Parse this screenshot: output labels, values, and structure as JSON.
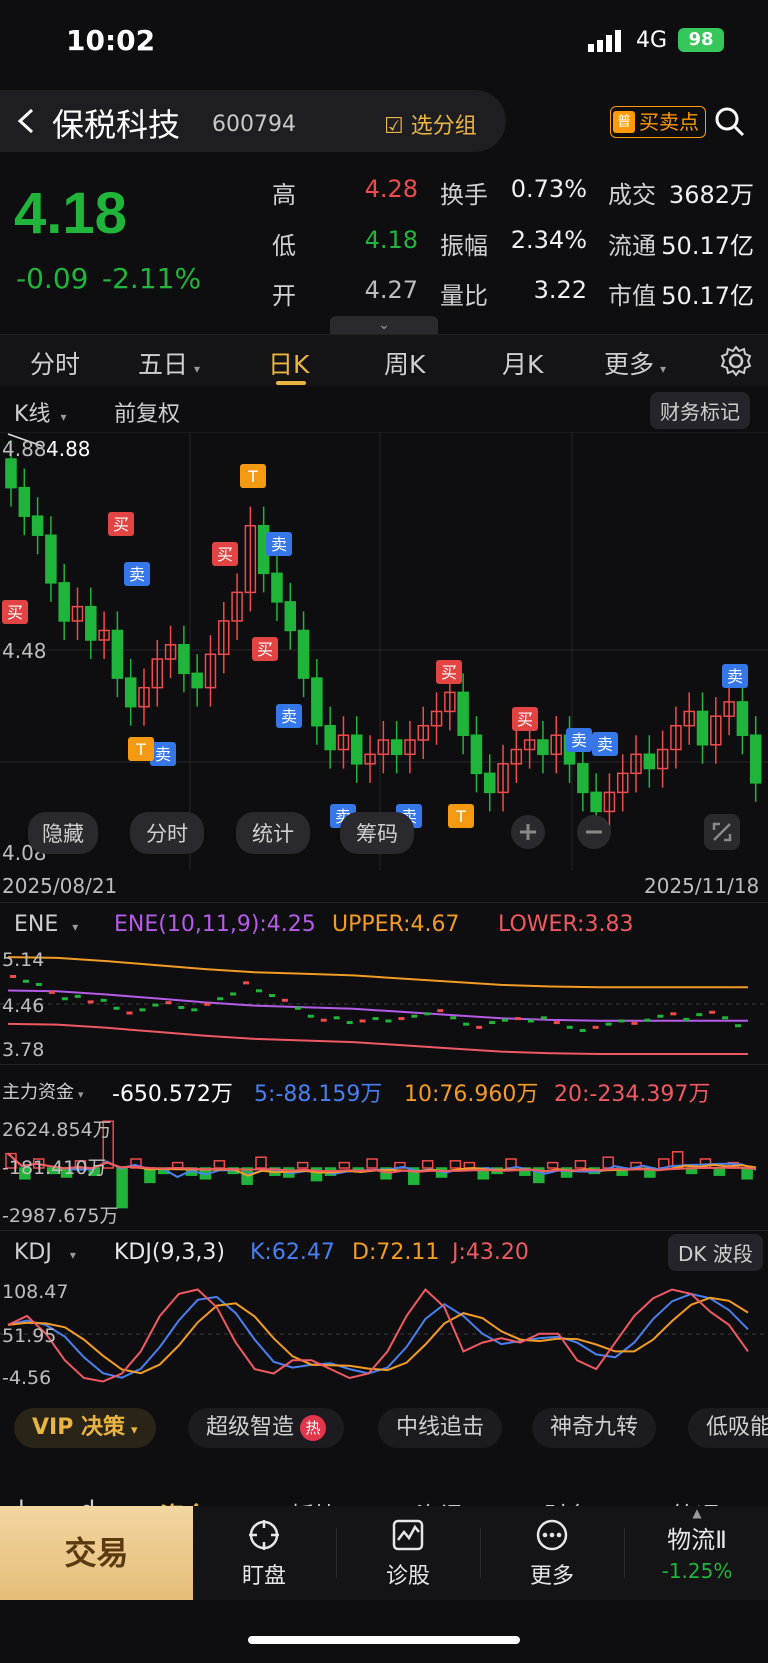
{
  "status": {
    "time": "10:02",
    "network": "4G",
    "battery": "98"
  },
  "header": {
    "stock_name": "保税科技",
    "stock_code": "600794",
    "group_label": "选分组",
    "bsp_badge": "普",
    "bsp_label": "买卖点"
  },
  "quote": {
    "price": "4.18",
    "change_abs": "-0.09",
    "change_pct": "-2.11%",
    "rows": [
      {
        "l1": "高",
        "v1": "4.28",
        "l2": "换手",
        "v2": "0.73%",
        "l3": "成交",
        "v3": "3682万"
      },
      {
        "l1": "低",
        "v1": "4.18",
        "l2": "振幅",
        "v2": "2.34%",
        "l3": "流通",
        "v3": "50.17亿"
      },
      {
        "l1": "开",
        "v1": "4.27",
        "l2": "量比",
        "v2": "3.22",
        "l3": "市值",
        "v3": "50.17亿"
      }
    ]
  },
  "period_tabs": [
    "分时",
    "五日",
    "日K",
    "周K",
    "月K",
    "更多"
  ],
  "kline": {
    "type_label": "K线",
    "adjust_label": "前复权",
    "finance_mark": "财务标记",
    "price_high": "4.88",
    "price_mid": "4.48",
    "price_low": "4.08",
    "date_start": "2025/08/21",
    "date_end": "2025/11/18",
    "chips": [
      "隐藏",
      "分时",
      "统计",
      "筹码"
    ]
  },
  "signals": {
    "buy": "买",
    "sell": "卖",
    "t": "T"
  },
  "ene": {
    "label": "ENE",
    "params": "ENE(10,11,9):4.25",
    "upper": "UPPER:4.67",
    "lower": "LOWER:3.83",
    "axis_top": "5.14",
    "axis_mid": "4.46",
    "axis_bot": "3.78"
  },
  "capital": {
    "label": "主力资金",
    "value": "-650.572万",
    "ma5": "5:-88.159万",
    "ma10": "10:76.960万",
    "ma20": "20:-234.397万",
    "axis_top": "2624.854万",
    "axis_mid": "-181.410万",
    "axis_bot": "-2987.675万"
  },
  "kdj": {
    "label": "KDJ",
    "params": "KDJ(9,3,3)",
    "k": "K:62.47",
    "d": "D:72.11",
    "j": "J:43.20",
    "dk_label": "DK 波段",
    "axis_top": "108.47",
    "axis_mid": "51.95",
    "axis_bot": "-4.56"
  },
  "decision": {
    "vip": "VIP 决策",
    "items": [
      "超级智造",
      "中线追击",
      "神奇九转",
      "低吸能"
    ],
    "hot": "热"
  },
  "bottom_peek": [
    "l",
    "d",
    "资金",
    "板块",
    "资讯",
    "财务",
    "简况"
  ],
  "bottom_nav": {
    "trade": "交易",
    "items": [
      "盯盘",
      "诊股",
      "更多"
    ],
    "sector_name": "物流Ⅱ",
    "sector_change": "-1.25%"
  },
  "colors": {
    "up": "#f04b4b",
    "down": "#1fb53a",
    "accent": "#e9b441"
  }
}
